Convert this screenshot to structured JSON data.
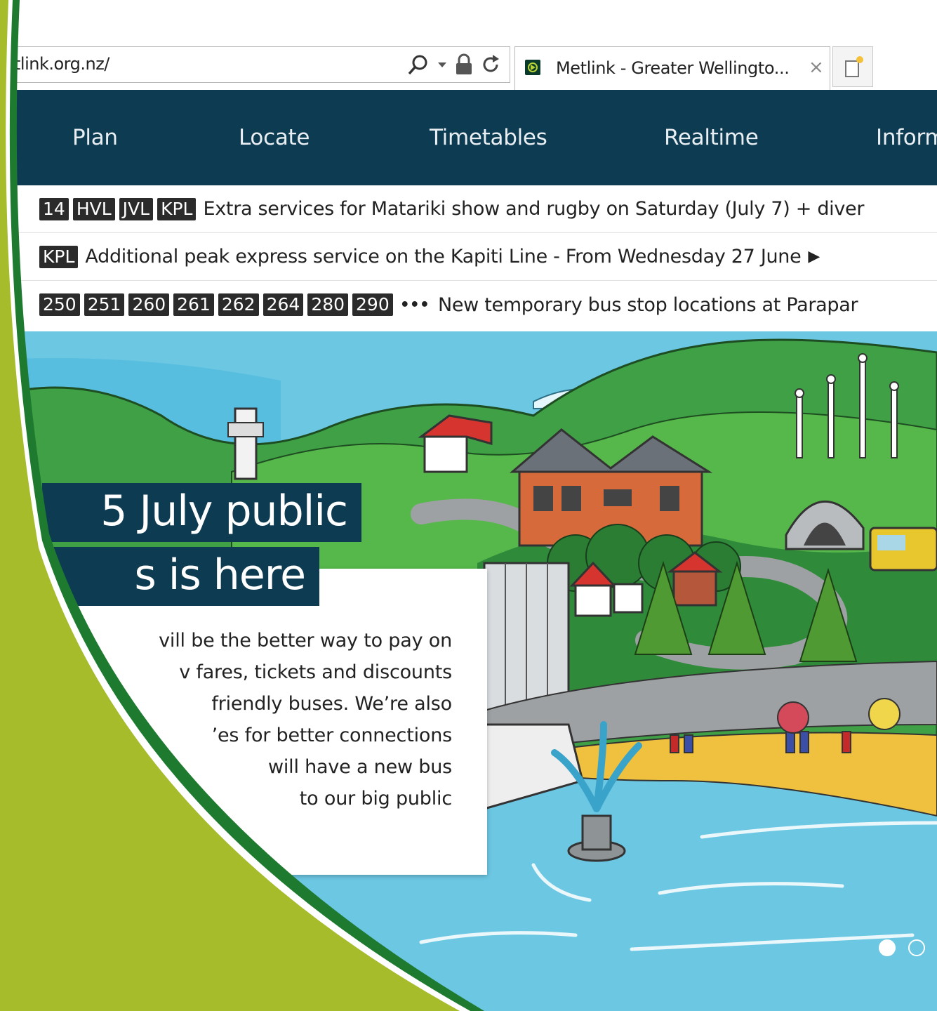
{
  "browser": {
    "address_text": "tlink.org.nz/",
    "tab_title": "Metlink - Greater Wellingto...",
    "tab_close": "×",
    "icons": [
      "search-icon",
      "dropdown-icon",
      "lock-icon",
      "refresh-icon",
      "favicon",
      "new-tab-icon"
    ]
  },
  "nav": {
    "items": [
      {
        "label": "Plan"
      },
      {
        "label": "Locate"
      },
      {
        "label": "Timetables"
      },
      {
        "label": "Realtime"
      },
      {
        "label": "Inform"
      }
    ]
  },
  "alerts": [
    {
      "tags": [
        "14",
        "HVL",
        "JVL",
        "KPL"
      ],
      "text": "Extra services for Matariki show and rugby on Saturday (July 7) + diver",
      "has_arrow": false
    },
    {
      "tags": [
        "KPL"
      ],
      "text": "Additional peak express service on the Kapiti Line - From Wednesday 27 June",
      "has_arrow": true,
      "arrow": "▶"
    },
    {
      "tags": [
        "250",
        "251",
        "260",
        "261",
        "262",
        "264",
        "280",
        "290"
      ],
      "dots": "•••",
      "text": "New temporary bus stop locations at Parapar",
      "has_arrow": false
    }
  ],
  "hero": {
    "title_line1": "5 July public",
    "title_line2": "s is here",
    "card_lines": [
      "vill be the better way to pay on",
      "v fares, tickets and discounts",
      "friendly buses. We’re also",
      "’es for better connections",
      "will have a new bus",
      "to our big public"
    ],
    "carousel": {
      "count": 2,
      "active_index": 0
    }
  },
  "colors": {
    "nav_bg": "#0d3b52",
    "tag_bg": "#2b2b2b",
    "frame_green": "#a6bc2b",
    "frame_dark_green": "#1e7a2e"
  }
}
